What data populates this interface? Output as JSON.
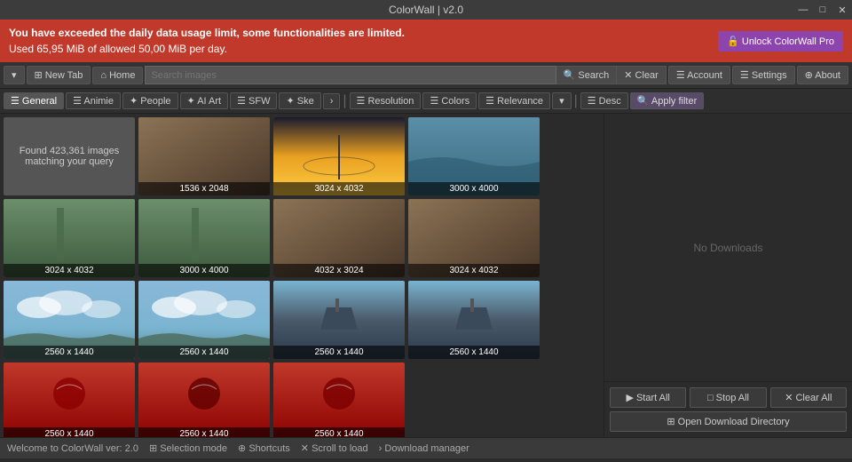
{
  "titlebar": {
    "title": "ColorWall | v2.0",
    "minimize_label": "—",
    "maximize_label": "□",
    "close_label": "✕"
  },
  "alert": {
    "line1": "You have exceeded the daily data usage limit, some functionalities are limited.",
    "line2": "Used 65,95 MiB of allowed 50,00 MiB per day.",
    "unlock_label": "🔓 Unlock ColorWall Pro"
  },
  "toolbar": {
    "dropdown_label": "▾",
    "new_tab_label": "⊞ New Tab",
    "home_label": "⌂ Home",
    "search_placeholder": "Search images",
    "search_btn": "🔍 Search",
    "clear_btn": "✕ Clear",
    "account_label": "☰ Account",
    "settings_label": "☰ Settings",
    "about_label": "⊕ About"
  },
  "filters": {
    "general_label": "☰ General",
    "animie_label": "☰ Animie",
    "people_label": "✦ People",
    "ai_art_label": "✦ AI Art",
    "sfw_label": "☰ SFW",
    "sketch_label": "✦ Ske",
    "more_label": "›",
    "resolution_label": "☰ Resolution",
    "colors_label": "☰ Colors",
    "relevance_label": "☰ Relevance",
    "more2_label": "▾",
    "desc_label": "☰ Desc",
    "apply_label": "🔍 Apply filter"
  },
  "grid": {
    "found_text": "Found 423,361 images",
    "found_subtext": "matching your query",
    "images": [
      {
        "size": "1536 x 2048",
        "color1": "#8B7355",
        "color2": "#4a3728",
        "type": "portrait"
      },
      {
        "size": "3024 x 4032",
        "color1": "#E8A020",
        "color2": "#1a1a2e",
        "type": "sunset"
      },
      {
        "size": "3000 x 4000",
        "color1": "#5B8FA8",
        "color2": "#3a6a80",
        "type": "water"
      },
      {
        "size": "3024 x 4032",
        "color1": "#6B8E6B",
        "color2": "#8fa070",
        "type": "nature"
      },
      {
        "size": "3000 x 4000",
        "color1": "#5a7a5a",
        "color2": "#3d5a3d",
        "type": "waterfall"
      },
      {
        "size": "4032 x 3024",
        "color1": "#8B9090",
        "color2": "#555a55",
        "type": "canyon"
      },
      {
        "size": "3024 x 4032",
        "color1": "#7a6a5a",
        "color2": "#5a4a3a",
        "type": "rocks"
      },
      {
        "size": "2560 x 1440",
        "color1": "#7ab4d0",
        "color2": "#a0c8e0",
        "type": "landscape"
      },
      {
        "size": "2560 x 1440",
        "color1": "#8ab8d8",
        "color2": "#b0d0e8",
        "type": "clouds"
      },
      {
        "size": "2560 x 1440",
        "color1": "#4a5a6a",
        "color2": "#2a3a4a",
        "type": "ship"
      },
      {
        "size": "2560 x 1440",
        "color1": "#5a6a7a",
        "color2": "#3a4a5a",
        "type": "ship2"
      },
      {
        "size": "2560 x 1440",
        "color1": "#c0392b",
        "color2": "#8b0000",
        "type": "spiderman"
      },
      {
        "size": "2560 x 1440",
        "color1": "#8b0000",
        "color2": "#600000",
        "type": "spiderman2"
      },
      {
        "size": "2560 x 1440",
        "color1": "#c0392b",
        "color2": "#7a0000",
        "type": "spiderman3"
      }
    ]
  },
  "right_panel": {
    "no_downloads": "No Downloads",
    "start_all": "▶ Start All",
    "stop_all": "□ Stop All",
    "clear_all": "✕ Clear All",
    "open_dir": "⊞ Open Download Directory"
  },
  "statusbar": {
    "welcome": "Welcome to ColorWall ver: 2.0",
    "selection_mode": "⊞ Selection mode",
    "shortcuts": "⊕ Shortcuts",
    "scroll": "✕ Scroll to load",
    "download_mgr": "› Download manager"
  }
}
